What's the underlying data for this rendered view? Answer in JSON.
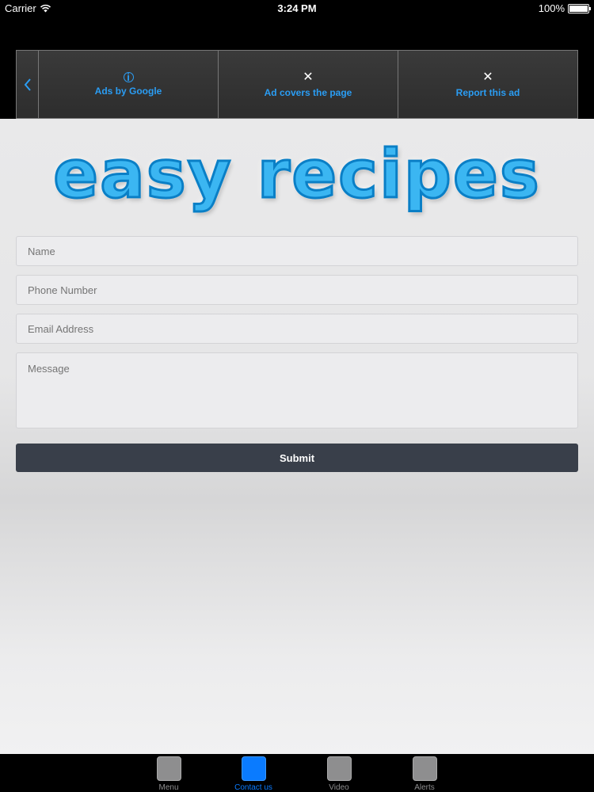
{
  "status_bar": {
    "carrier": "Carrier",
    "time": "3:24 PM",
    "battery": "100%"
  },
  "ad_bar": {
    "items": [
      {
        "label": "Ads by Google",
        "icon": "info-icon"
      },
      {
        "label": "Ad covers the page",
        "icon": "close-icon"
      },
      {
        "label": "Report this ad",
        "icon": "close-icon"
      }
    ]
  },
  "logo": {
    "text": "easy recipes"
  },
  "form": {
    "name_placeholder": "Name",
    "phone_placeholder": "Phone Number",
    "email_placeholder": "Email Address",
    "message_placeholder": "Message",
    "submit_label": "Submit"
  },
  "tab_bar": {
    "tabs": [
      {
        "label": "Menu"
      },
      {
        "label": "Contact us"
      },
      {
        "label": "Video"
      },
      {
        "label": "Alerts"
      }
    ],
    "active_color": "#0a7bff",
    "inactive_color": "#8e8e8f"
  },
  "colors": {
    "accent": "#2a9df4",
    "submit_bg": "#393f4a"
  }
}
